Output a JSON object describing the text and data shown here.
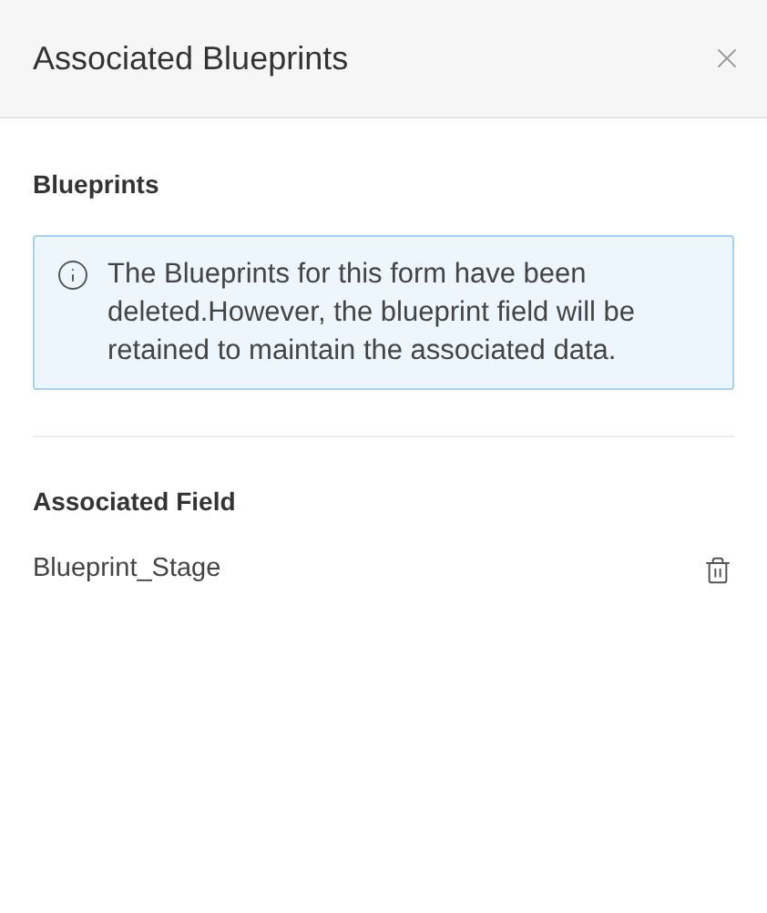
{
  "dialog": {
    "title": "Associated Blueprints"
  },
  "blueprints_section": {
    "heading": "Blueprints",
    "notice": "The Blueprints for this form have been deleted.However, the blueprint field will be retained to maintain the associated data."
  },
  "associated_field_section": {
    "heading": "Associated Field",
    "fields": [
      {
        "name": "Blueprint_Stage"
      }
    ]
  }
}
